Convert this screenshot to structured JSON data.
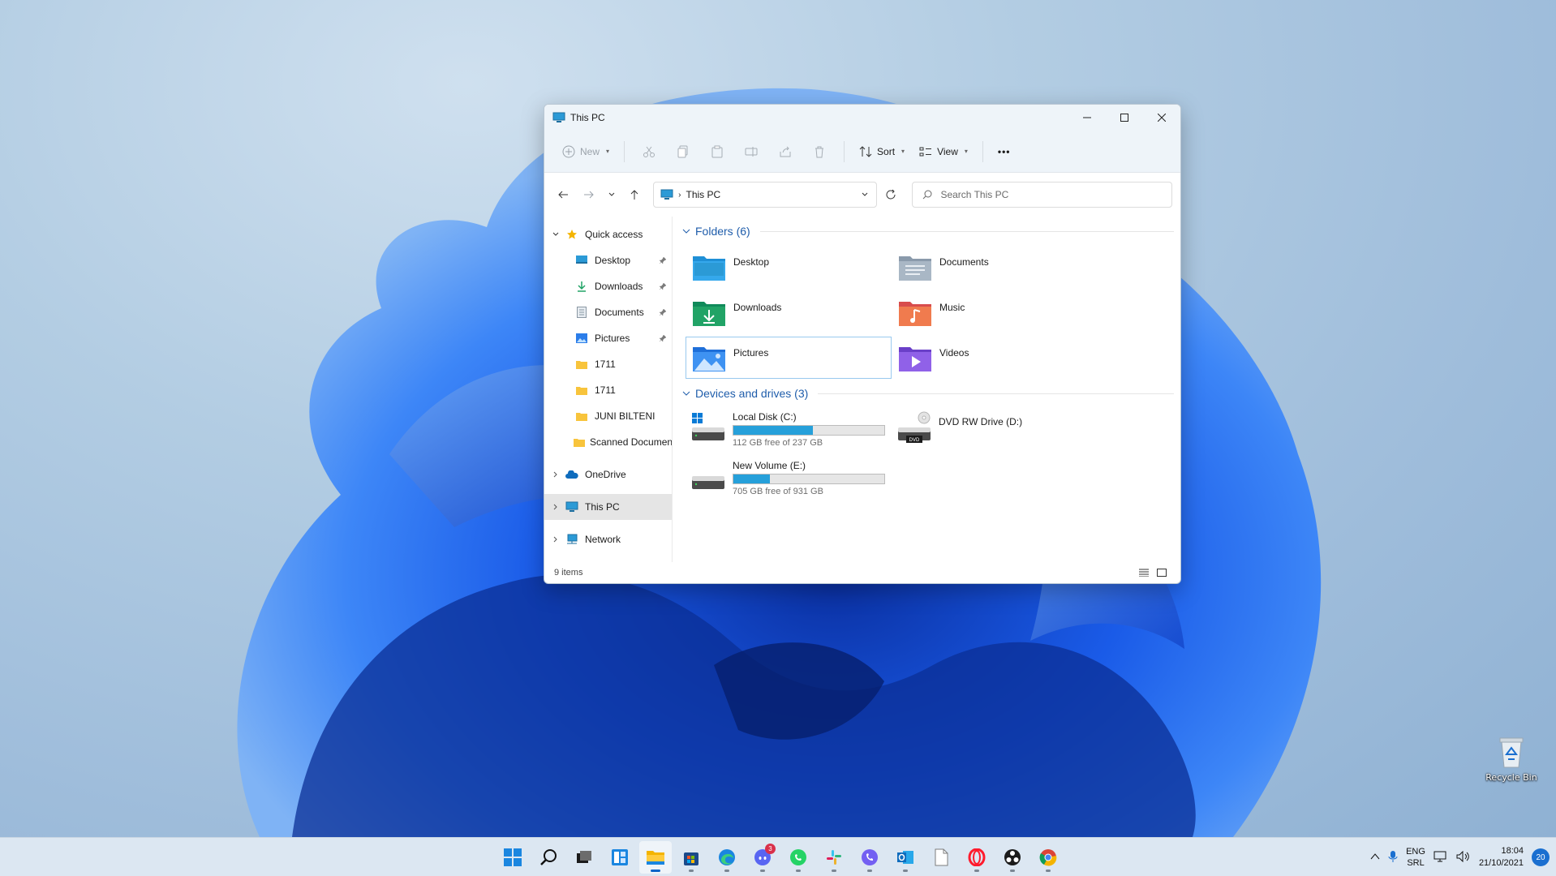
{
  "window": {
    "title": "This PC"
  },
  "toolbar": {
    "new_label": "New",
    "sort_label": "Sort",
    "view_label": "View",
    "more_label": "•••"
  },
  "navbar": {
    "address": "This PC",
    "search_placeholder": "Search This PC"
  },
  "sidebar": {
    "quick_access": "Quick access",
    "quick_items": [
      {
        "label": "Desktop",
        "icon": "desktop-icon",
        "pinned": true
      },
      {
        "label": "Downloads",
        "icon": "downloads-icon",
        "pinned": true
      },
      {
        "label": "Documents",
        "icon": "documents-icon",
        "pinned": true
      },
      {
        "label": "Pictures",
        "icon": "pictures-icon",
        "pinned": true
      },
      {
        "label": "1711",
        "icon": "folder-icon",
        "pinned": false
      },
      {
        "label": "1711",
        "icon": "folder-icon",
        "pinned": false
      },
      {
        "label": "JUNI BILTENI",
        "icon": "folder-icon",
        "pinned": false
      },
      {
        "label": "Scanned Documents",
        "icon": "folder-icon",
        "pinned": false
      }
    ],
    "onedrive": "OneDrive",
    "this_pc": "This PC",
    "network": "Network"
  },
  "content": {
    "folders_header": "Folders (6)",
    "folders": [
      {
        "label": "Desktop",
        "icon": "desktop-folder-icon"
      },
      {
        "label": "Documents",
        "icon": "documents-folder-icon"
      },
      {
        "label": "Downloads",
        "icon": "downloads-folder-icon"
      },
      {
        "label": "Music",
        "icon": "music-folder-icon"
      },
      {
        "label": "Pictures",
        "icon": "pictures-folder-icon"
      },
      {
        "label": "Videos",
        "icon": "videos-folder-icon"
      }
    ],
    "drives_header": "Devices and drives (3)",
    "drives": [
      {
        "label": "Local Disk (C:)",
        "free": "112 GB free of 237 GB",
        "used_fraction": 0.527
      },
      {
        "label": "DVD RW Drive (D:)",
        "free": "",
        "badge": "DVD"
      },
      {
        "label": "New Volume (E:)",
        "free": "705 GB free of 931 GB",
        "used_fraction": 0.243
      }
    ]
  },
  "status": {
    "items": "9 items"
  },
  "desktop": {
    "recycle_bin": "Recycle Bin"
  },
  "taskbar": {
    "apps": [
      "start-icon",
      "search-icon",
      "task-view-icon",
      "widgets-icon",
      "file-explorer-icon",
      "store-icon",
      "edge-icon",
      "discord-icon",
      "whatsapp-icon",
      "slack-icon",
      "viber-icon",
      "outlook-icon",
      "notepad-icon",
      "opera-icon",
      "obs-icon",
      "chrome-icon"
    ],
    "discord_badge": "3",
    "lang_top": "ENG",
    "lang_bottom": "SRL",
    "time": "18:04",
    "date": "21/10/2021",
    "notifications": "20"
  },
  "colors": {
    "accent": "#0a64c8",
    "drive_bar": "#26a0da",
    "group_header": "#1f5dab"
  }
}
